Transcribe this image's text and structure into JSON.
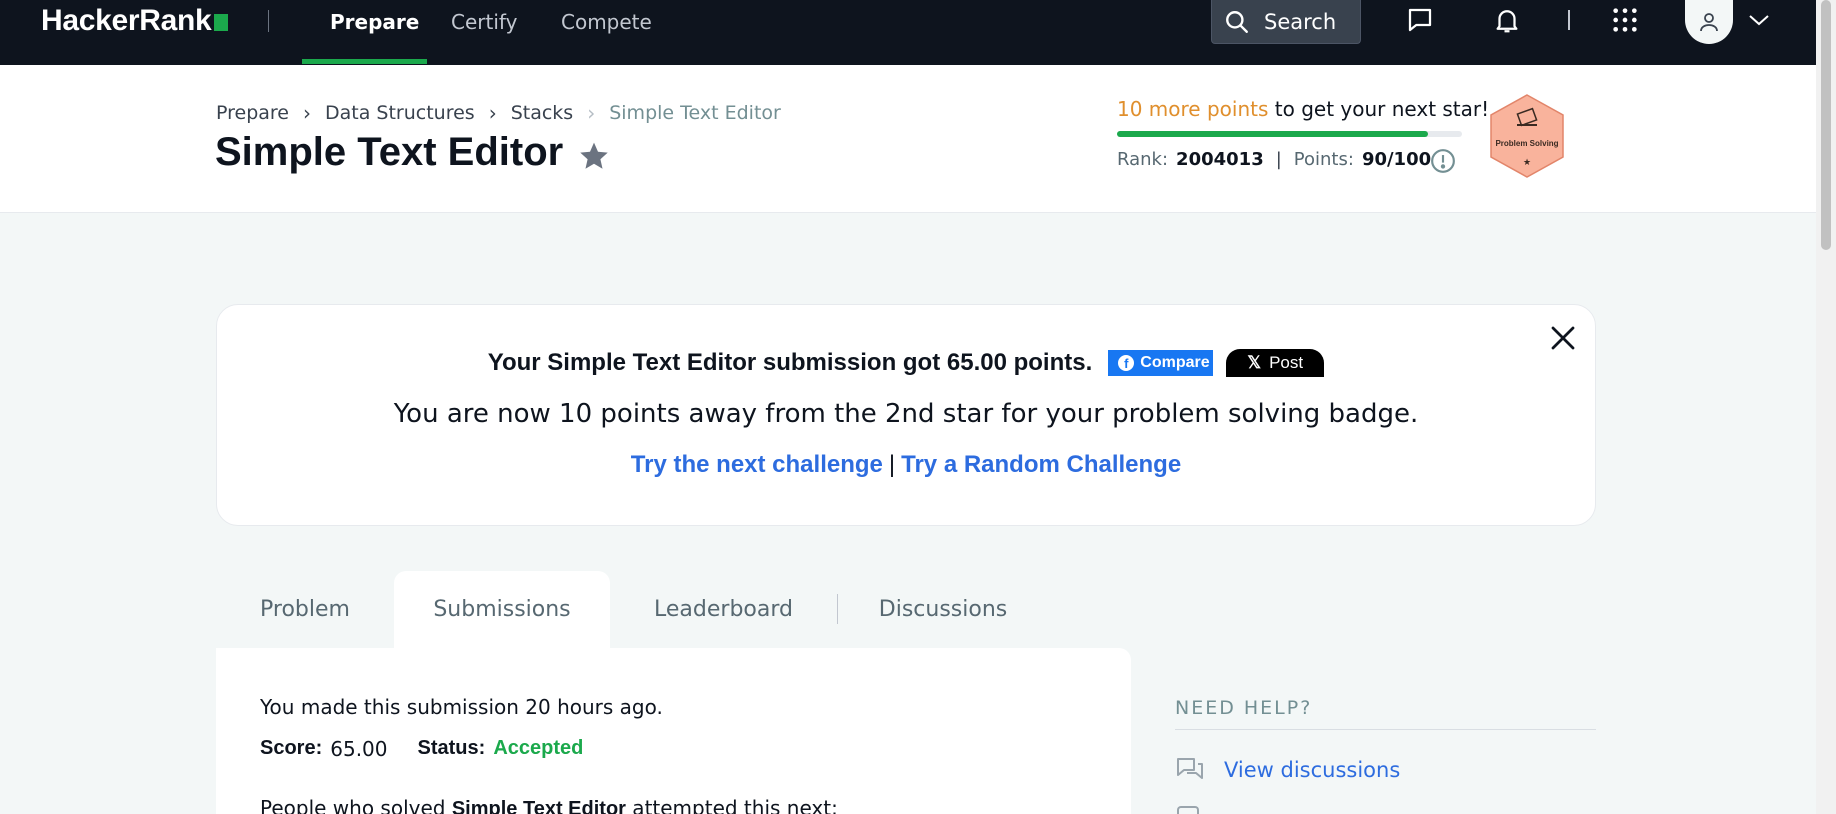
{
  "nav": {
    "logo": "HackerRank",
    "links": [
      {
        "label": "Prepare",
        "active": true
      },
      {
        "label": "Certify",
        "active": false
      },
      {
        "label": "Compete",
        "active": false
      }
    ],
    "search_label": "Search",
    "icons": [
      "messages-icon",
      "notifications-icon",
      "apps-grid-icon",
      "user-avatar-icon",
      "chevron-down-icon"
    ]
  },
  "header": {
    "breadcrumb": [
      "Prepare",
      "Data Structures",
      "Stacks",
      "Simple Text Editor"
    ],
    "title": "Simple Text Editor",
    "progress": {
      "points_text": "10 more points",
      "rest_text": " to get your next star!",
      "fraction": 0.9
    },
    "rank_label": "Rank:",
    "rank_value": "2004013",
    "points_label": "Points:",
    "points_value": "90/100",
    "badge_label": "Problem Solving"
  },
  "notification": {
    "title": "Your Simple Text Editor submission got 65.00 points.",
    "facebook_label": "Compare",
    "x_label": "Post",
    "message": "You are now 10 points away from the 2nd star for your problem solving badge.",
    "next_link": "Try the next challenge",
    "separator": "|",
    "random_link": "Try a Random Challenge"
  },
  "tabs": [
    {
      "label": "Problem",
      "active": false
    },
    {
      "label": "Submissions",
      "active": true
    },
    {
      "label": "Leaderboard",
      "active": false
    },
    {
      "label": "Discussions",
      "active": false
    }
  ],
  "submission": {
    "made_text": "You made this submission 20 hours ago.",
    "score_label": "Score:",
    "score_value": "65.00",
    "status_label": "Status:",
    "status_value": "Accepted",
    "next_prefix": "People who solved ",
    "next_bold": "Simple Text Editor",
    "next_suffix": " attempted this next:"
  },
  "help": {
    "heading": "NEED HELP?",
    "discussions_link": "View discussions"
  },
  "colors": {
    "brand_green": "#1ba94c",
    "nav_bg": "#0e141e",
    "link_blue": "#2d6cdf",
    "points_orange": "#e08f2d",
    "facebook_blue": "#1877f2"
  }
}
